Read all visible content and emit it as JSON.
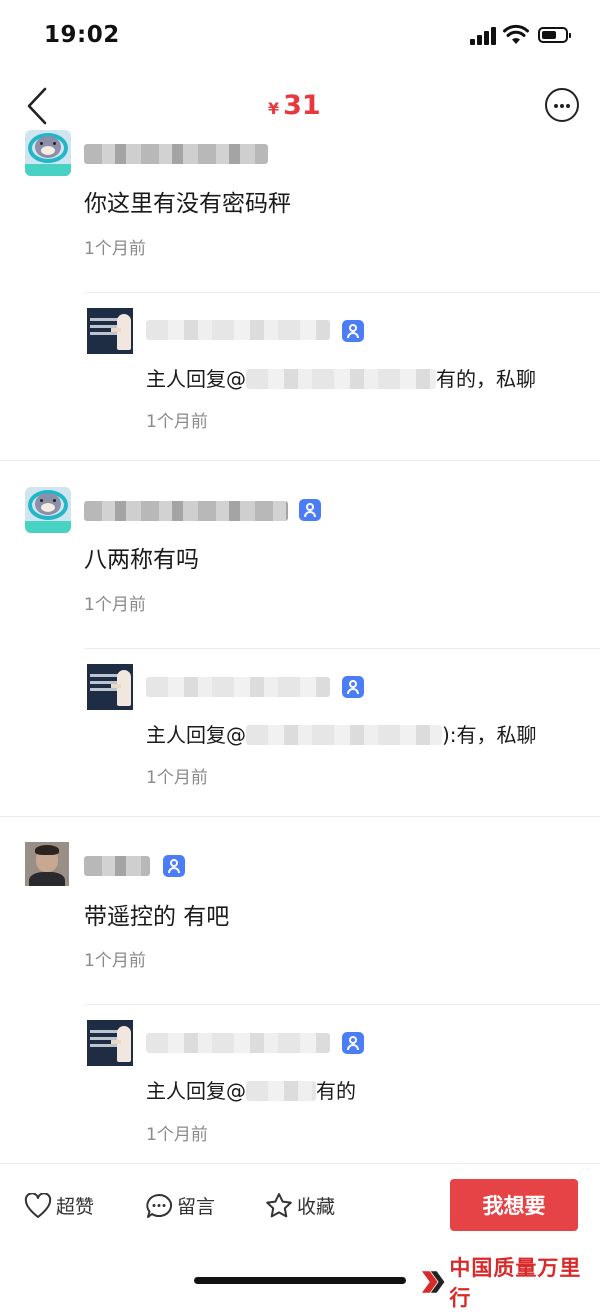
{
  "status_bar": {
    "time": "19:02"
  },
  "nav": {
    "price_currency": "¥",
    "price_value": "31"
  },
  "comments": [
    {
      "text": "你这里有没有密码秤",
      "time": "1个月前",
      "reply": {
        "prefix": "主人回复@",
        "suffix": "有的，私聊",
        "time": "1个月前"
      }
    },
    {
      "text": "八两称有吗",
      "time": "1个月前",
      "reply": {
        "prefix": "主人回复@",
        "suffix": "):有，私聊",
        "time": "1个月前"
      }
    },
    {
      "text": "带遥控的 有吧",
      "time": "1个月前",
      "reply": {
        "prefix": "主人回复@",
        "suffix": "有的",
        "time": "1个月前"
      }
    }
  ],
  "bottom_bar": {
    "like_label": "超赞",
    "comment_label": "留言",
    "favorite_label": "收藏",
    "want_label": "我想要"
  },
  "watermark": {
    "text": "中国质量万里行"
  },
  "colors": {
    "accent": "#e54346",
    "price": "#e8383d",
    "badge": "#4b7df7",
    "time_text": "#8a8a8a"
  },
  "icons": [
    "back-icon",
    "more-icon",
    "verified-badge-icon",
    "heart-icon",
    "comment-bubble-icon",
    "star-icon"
  ]
}
